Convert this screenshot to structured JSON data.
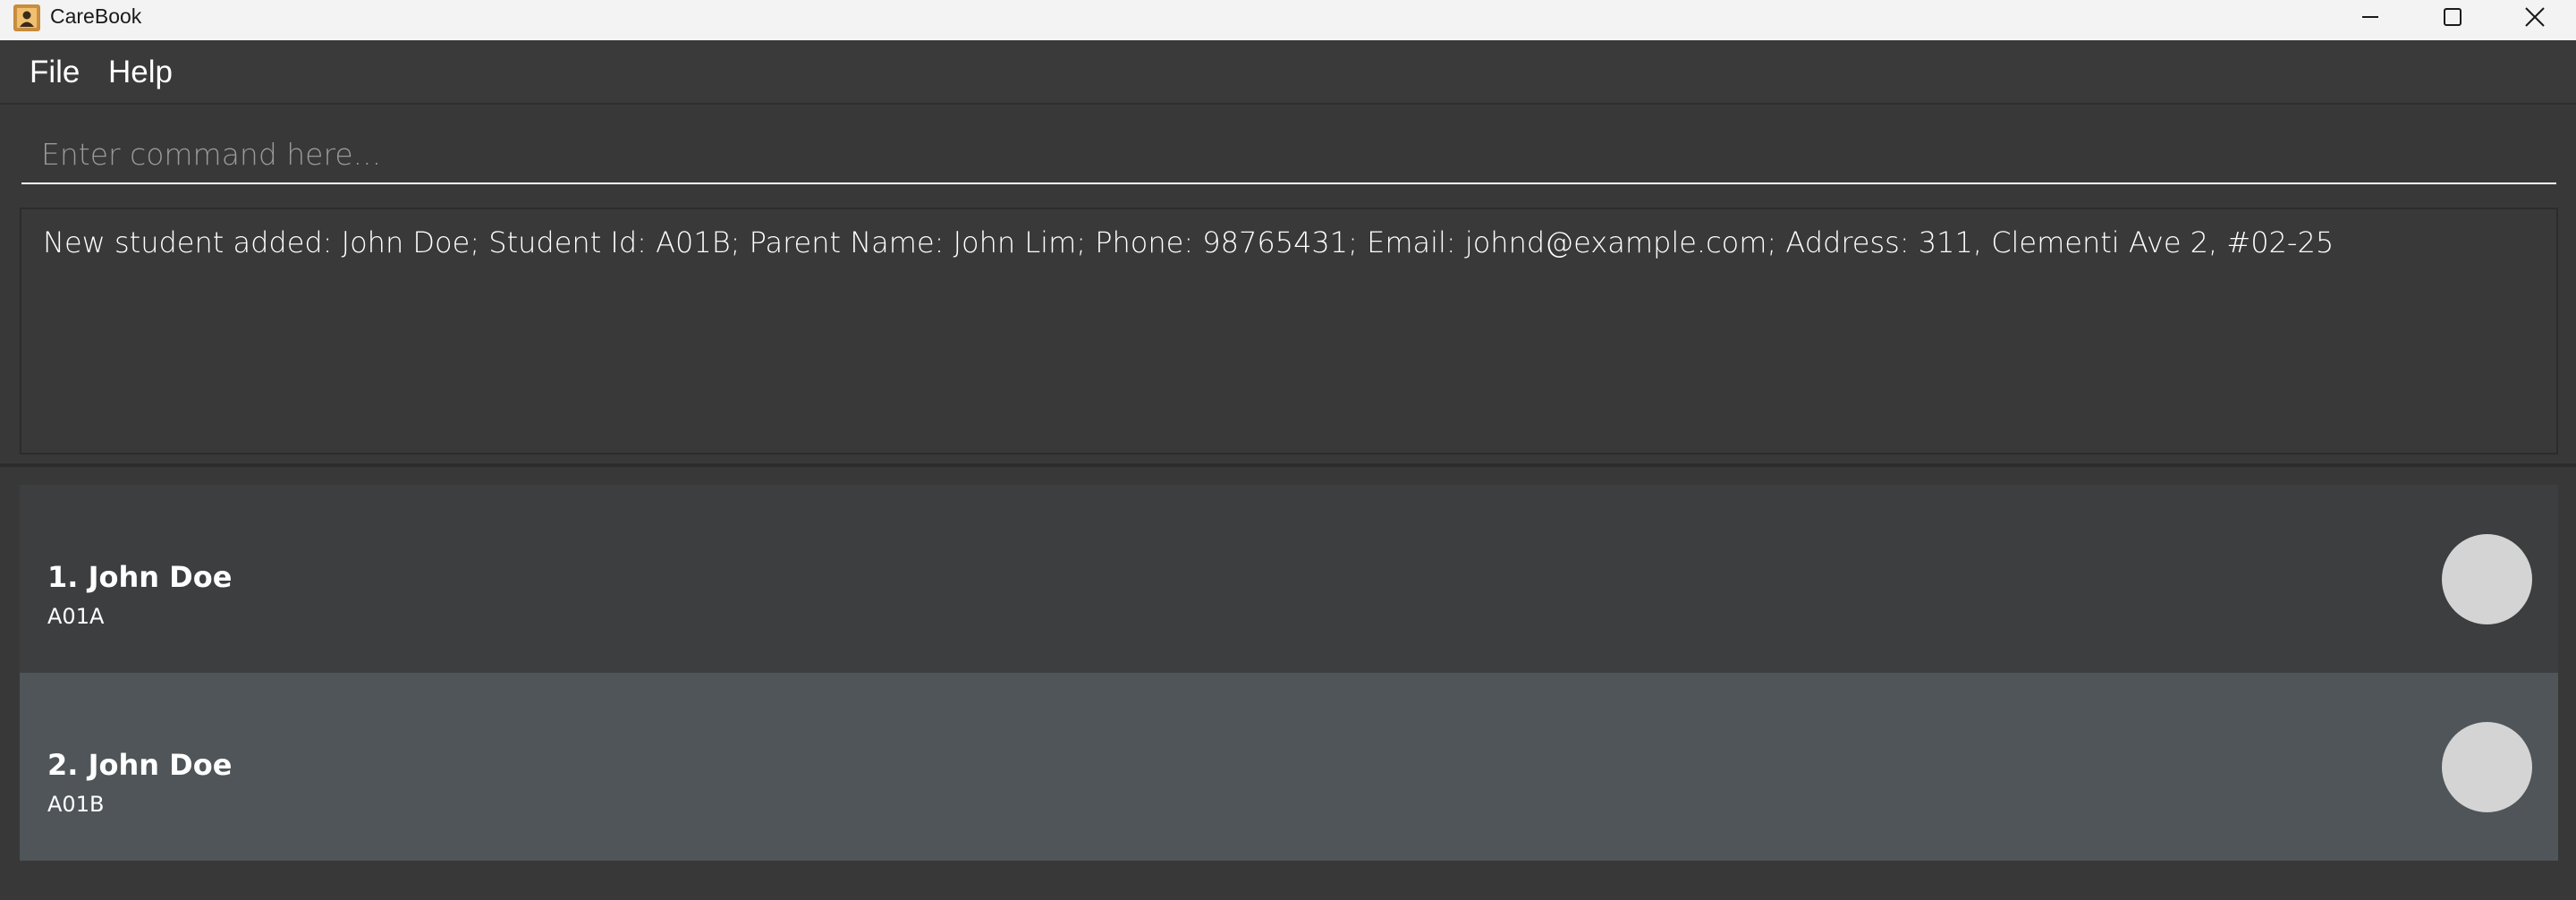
{
  "window": {
    "title": "CareBook",
    "app_icon": "contact-book-icon"
  },
  "menu": {
    "file_label": "File",
    "help_label": "Help"
  },
  "command": {
    "placeholder": "Enter command here...",
    "value": ""
  },
  "result": {
    "message": "New student added: John Doe; Student Id: A01B; Parent Name: John Lim; Phone: 98765431; Email: johnd@example.com; Address: 311, Clementi Ave 2, #02-25"
  },
  "students": [
    {
      "index_name": "1. John Doe",
      "student_id": "A01A"
    },
    {
      "index_name": "2. John Doe",
      "student_id": "A01B"
    }
  ],
  "colors": {
    "titlebar_bg": "#f3f3f3",
    "app_bg": "#383838",
    "card_bg": "#3c3e3f",
    "card_selected_bg": "#4f5558",
    "avatar": "#d4d4d4"
  }
}
